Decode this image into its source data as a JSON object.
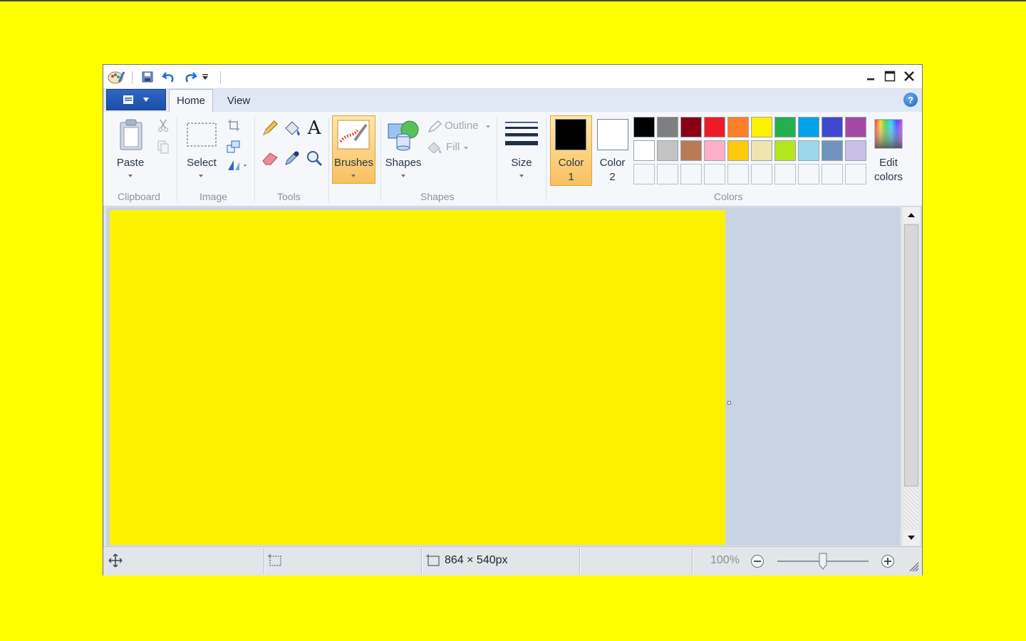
{
  "window": {
    "tabs": [
      {
        "label": "Home",
        "active": true
      },
      {
        "label": "View",
        "active": false
      }
    ],
    "help_label": "?"
  },
  "ribbon": {
    "clipboard": {
      "group": "Clipboard",
      "paste": "Paste"
    },
    "image": {
      "group": "Image",
      "select": "Select"
    },
    "tools": {
      "group": "Tools",
      "text_tool": "A"
    },
    "brushes": {
      "label": "Brushes"
    },
    "shapes": {
      "group": "Shapes",
      "shapes": "Shapes",
      "outline": "Outline",
      "fill": "Fill"
    },
    "size": {
      "label": "Size"
    },
    "colors": {
      "group": "Colors",
      "color1_line1": "Color",
      "color1_line2": "1",
      "color2_line1": "Color",
      "color2_line2": "2",
      "edit_line1": "Edit",
      "edit_line2": "colors",
      "color1_value": "#000000",
      "color2_value": "#ffffff",
      "palette_row1": [
        "#000000",
        "#7f7f7f",
        "#880015",
        "#ed1c24",
        "#ff7f27",
        "#fff200",
        "#22b14c",
        "#00a2e8",
        "#3f48cc",
        "#a349a4"
      ],
      "palette_row2": [
        "#ffffff",
        "#c3c3c3",
        "#b97a57",
        "#ffaec9",
        "#ffc90e",
        "#efe4b0",
        "#b5e61d",
        "#99d9ea",
        "#7092be",
        "#c8bfe7"
      ]
    }
  },
  "canvas": {
    "fill_color": "#fff200"
  },
  "statusbar": {
    "image_size": "864 × 540px",
    "zoom": "100%",
    "zoom_fraction": 0.5
  }
}
